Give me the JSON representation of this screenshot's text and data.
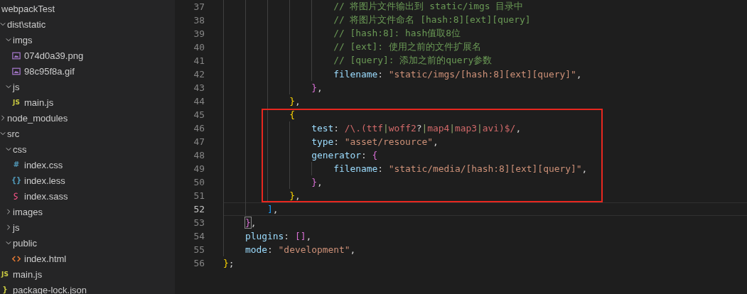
{
  "explorer": {
    "root": "webpackTest",
    "items": [
      {
        "name": "dist\\static",
        "kind": "folder",
        "expanded": true,
        "children": [
          {
            "name": "imgs",
            "kind": "folder",
            "expanded": true,
            "children": [
              {
                "name": "074d0a39.png",
                "kind": "image"
              },
              {
                "name": "98c95f8a.gif",
                "kind": "image"
              }
            ]
          },
          {
            "name": "js",
            "kind": "folder",
            "expanded": true,
            "children": [
              {
                "name": "main.js",
                "kind": "js",
                "icon": "JS"
              }
            ]
          }
        ]
      },
      {
        "name": "node_modules",
        "kind": "folder",
        "expanded": false
      },
      {
        "name": "src",
        "kind": "folder",
        "expanded": true,
        "children": [
          {
            "name": "css",
            "kind": "folder",
            "expanded": true,
            "children": [
              {
                "name": "index.css",
                "kind": "css",
                "icon": "#"
              },
              {
                "name": "index.less",
                "kind": "less",
                "icon": "{}"
              },
              {
                "name": "index.sass",
                "kind": "sass"
              }
            ]
          },
          {
            "name": "images",
            "kind": "folder",
            "expanded": false
          },
          {
            "name": "js",
            "kind": "folder",
            "expanded": false
          },
          {
            "name": "public",
            "kind": "folder",
            "expanded": true,
            "children": [
              {
                "name": "index.html",
                "kind": "html"
              }
            ]
          }
        ]
      },
      {
        "name": "main.js",
        "kind": "js",
        "icon": "JS"
      },
      {
        "name": "package-lock.json",
        "kind": "json",
        "icon": "}"
      }
    ]
  },
  "editor": {
    "blocks": [
      {
        "lines": [
          {
            "number": "37",
            "current": false,
            "tokens": [
              {
                "kind": "comment",
                "text": "                    // 将图片文件输出到 static/imgs 目录中"
              }
            ]
          },
          {
            "number": "38",
            "current": false,
            "tokens": [
              {
                "kind": "comment",
                "text": "                    // 将图片文件命名 [hash:8][ext][query]"
              }
            ]
          },
          {
            "number": "39",
            "current": false,
            "tokens": [
              {
                "kind": "comment",
                "text": "                    // [hash:8]: hash值取8位"
              }
            ]
          },
          {
            "number": "40",
            "current": false,
            "tokens": [
              {
                "kind": "comment",
                "text": "                    // [ext]: 使用之前的文件扩展名"
              }
            ]
          },
          {
            "number": "41",
            "current": false,
            "tokens": [
              {
                "kind": "comment",
                "text": "                    // [query]: 添加之前的query参数"
              }
            ]
          },
          {
            "number": "42",
            "current": false,
            "tokens": [
              {
                "kind": "property",
                "text": "                    filename"
              },
              {
                "kind": "punct",
                "text": ": "
              },
              {
                "kind": "string",
                "text": "\"static/imgs/[hash:8][ext][query]\""
              },
              {
                "kind": "punct",
                "text": ","
              }
            ]
          },
          {
            "number": "43",
            "current": false,
            "tokens": [
              {
                "kind": "bracket2",
                "text": "                }"
              },
              {
                "kind": "punct",
                "text": ","
              }
            ]
          },
          {
            "number": "44",
            "current": false,
            "tokens": [
              {
                "kind": "bracket1",
                "text": "            }"
              },
              {
                "kind": "punct",
                "text": ","
              }
            ]
          }
        ]
      },
      {
        "highlighted": true,
        "lines": [
          {
            "number": "45",
            "current": false,
            "tokens": [
              {
                "kind": "bracket1",
                "text": "            {"
              }
            ]
          },
          {
            "number": "46",
            "current": false,
            "tokens": [
              {
                "kind": "property",
                "text": "                test"
              },
              {
                "kind": "punct",
                "text": ": "
              },
              {
                "kind": "regex",
                "text": "/\\.(ttf"
              },
              {
                "kind": "regex-operator",
                "text": "|"
              },
              {
                "kind": "regex",
                "text": "woff2"
              },
              {
                "kind": "punct",
                "text": "?"
              },
              {
                "kind": "regex-operator",
                "text": "|"
              },
              {
                "kind": "regex",
                "text": "map4"
              },
              {
                "kind": "regex-operator",
                "text": "|"
              },
              {
                "kind": "regex",
                "text": "map3"
              },
              {
                "kind": "regex-operator",
                "text": "|"
              },
              {
                "kind": "regex",
                "text": "avi)$/"
              },
              {
                "kind": "punct",
                "text": ","
              }
            ]
          },
          {
            "number": "47",
            "current": false,
            "tokens": [
              {
                "kind": "property",
                "text": "                type"
              },
              {
                "kind": "punct",
                "text": ": "
              },
              {
                "kind": "string",
                "text": "\"asset/resource\""
              },
              {
                "kind": "punct",
                "text": ","
              }
            ]
          },
          {
            "number": "48",
            "current": false,
            "tokens": [
              {
                "kind": "property",
                "text": "                generator"
              },
              {
                "kind": "punct",
                "text": ": "
              },
              {
                "kind": "bracket2",
                "text": "{"
              }
            ]
          },
          {
            "number": "49",
            "current": false,
            "tokens": [
              {
                "kind": "property",
                "text": "                    filename"
              },
              {
                "kind": "punct",
                "text": ": "
              },
              {
                "kind": "string",
                "text": "\"static/media/[hash:8][ext][query]\""
              },
              {
                "kind": "punct",
                "text": ","
              }
            ]
          },
          {
            "number": "50",
            "current": false,
            "tokens": [
              {
                "kind": "bracket2",
                "text": "                }"
              },
              {
                "kind": "punct",
                "text": ","
              }
            ]
          },
          {
            "number": "51",
            "current": false,
            "tokens": [
              {
                "kind": "bracket1",
                "text": "            }"
              },
              {
                "kind": "punct",
                "text": ","
              }
            ]
          }
        ]
      },
      {
        "lines": [
          {
            "number": "52",
            "current": true,
            "tokens": [
              {
                "kind": "bracket3",
                "text": "        ]"
              },
              {
                "kind": "punct",
                "text": ","
              }
            ]
          },
          {
            "number": "53",
            "current": false,
            "tokens": [
              {
                "kind": "bracket2",
                "text": "    }",
                "matched": true
              },
              {
                "kind": "punct",
                "text": ","
              }
            ]
          },
          {
            "number": "54",
            "current": false,
            "tokens": [
              {
                "kind": "property",
                "text": "    plugins"
              },
              {
                "kind": "punct",
                "text": ": "
              },
              {
                "kind": "bracket2",
                "text": "[]"
              },
              {
                "kind": "punct",
                "text": ","
              }
            ]
          },
          {
            "number": "55",
            "current": false,
            "tokens": [
              {
                "kind": "property",
                "text": "    mode"
              },
              {
                "kind": "punct",
                "text": ": "
              },
              {
                "kind": "string",
                "text": "\"development\""
              },
              {
                "kind": "punct",
                "text": ","
              }
            ]
          },
          {
            "number": "56",
            "current": false,
            "tokens": [
              {
                "kind": "bracket1",
                "text": "}"
              },
              {
                "kind": "punct",
                "text": ";"
              }
            ]
          }
        ]
      }
    ]
  }
}
